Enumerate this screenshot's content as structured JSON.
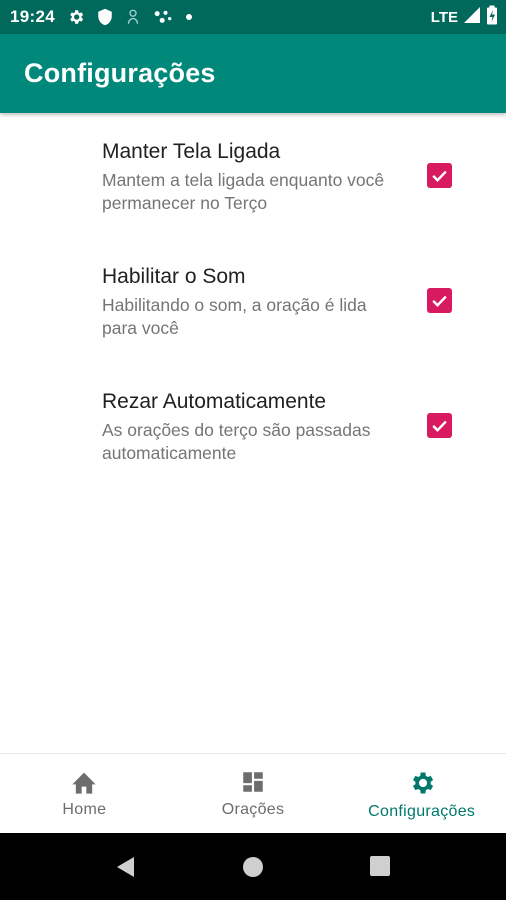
{
  "status_bar": {
    "time": "19:24",
    "network": "LTE",
    "icons": [
      "gear-icon",
      "shield-icon",
      "notification-icon",
      "dots-icon",
      "dot-icon",
      "signal-icon",
      "battery-icon"
    ]
  },
  "app_bar": {
    "title": "Configurações",
    "color": "#00897b"
  },
  "settings": [
    {
      "title": "Manter Tela Ligada",
      "summary": "Mantem a tela ligada enquanto você permanecer no Terço",
      "checked": true
    },
    {
      "title": "Habilitar o Som",
      "summary": "Habilitando o som, a oração é lida para você",
      "checked": true
    },
    {
      "title": "Rezar Automaticamente",
      "summary": "As orações do terço são passadas automaticamente",
      "checked": true
    }
  ],
  "bottom_nav": {
    "items": [
      {
        "label": "Home",
        "icon": "home-icon",
        "active": false
      },
      {
        "label": "Orações",
        "icon": "dashboard-icon",
        "active": false
      },
      {
        "label": "Configurações",
        "icon": "gear-icon",
        "active": true
      }
    ]
  },
  "colors": {
    "primary_dark": "#00695c",
    "primary": "#00897b",
    "accent": "#d81b60",
    "active_nav": "#00796b"
  }
}
